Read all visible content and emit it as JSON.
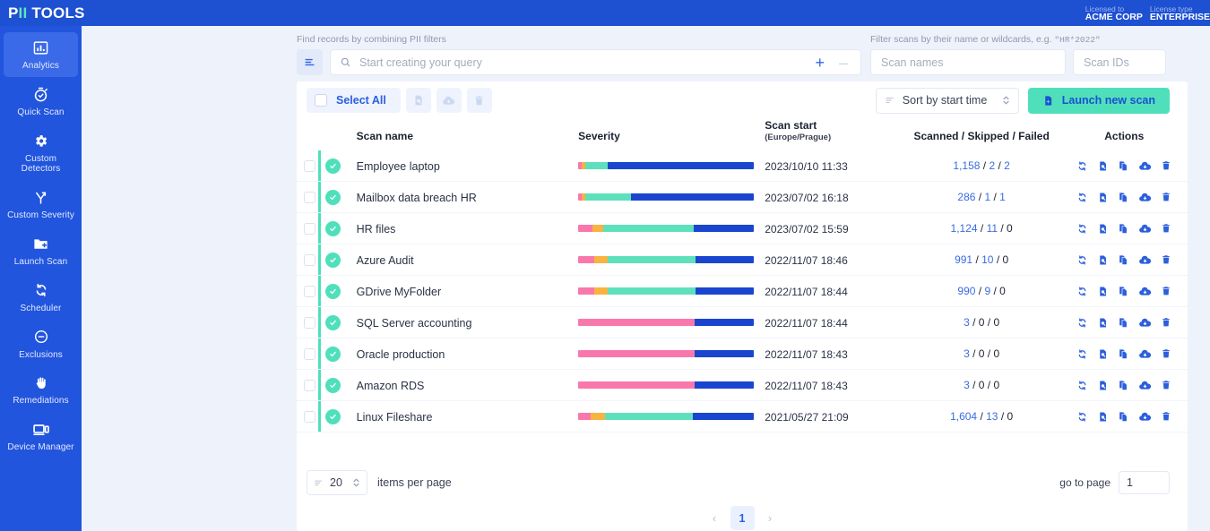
{
  "topbar": {
    "logo_prefix": "P",
    "logo_accent": "II",
    "logo_suffix": " TOOLS",
    "license": [
      {
        "label": "Licensed to",
        "value": "ACME CORP"
      },
      {
        "label": "License type",
        "value": "ENTERPRISE"
      }
    ]
  },
  "sidebar": {
    "items": [
      {
        "label": "Analytics",
        "icon": "chart-bar-icon",
        "active": true
      },
      {
        "label": "Quick Scan",
        "icon": "stopwatch-icon",
        "active": false
      },
      {
        "label": "Custom Detectors",
        "icon": "gear-icon",
        "active": false
      },
      {
        "label": "Custom Severity",
        "icon": "branch-icon",
        "active": false
      },
      {
        "label": "Launch Scan",
        "icon": "folder-plus-icon",
        "active": false
      },
      {
        "label": "Scheduler",
        "icon": "refresh-icon",
        "active": false
      },
      {
        "label": "Exclusions",
        "icon": "minus-circle-icon",
        "active": false
      },
      {
        "label": "Remediations",
        "icon": "hand-icon",
        "active": false
      },
      {
        "label": "Device Manager",
        "icon": "monitor-icon",
        "active": false
      }
    ]
  },
  "filters": {
    "query_hint": "Find records by combining PII filters",
    "query_placeholder": "Start creating your query",
    "query_value": "",
    "add_condition_label": "+",
    "remove_condition_label": "–",
    "scan_hint_prefix": "Filter scans by their name or wildcards, e.g. ",
    "scan_hint_example": "\"HR*2022\"",
    "scan_names_placeholder": "Scan names",
    "scan_names_value": "",
    "scan_ids_placeholder": "Scan IDs",
    "scan_ids_value": ""
  },
  "toolbar": {
    "select_all_label": "Select All",
    "disabled_actions": [
      "report-icon",
      "cloud-download-icon",
      "trash-icon"
    ],
    "sort_label": "Sort by start time",
    "launch_label": "Launch new scan"
  },
  "table": {
    "headers": {
      "scan_name": "Scan name",
      "severity": "Severity",
      "scan_start": "Scan start",
      "scan_start_tz": "(Europe/Prague)",
      "counts": "Scanned / Skipped / Failed",
      "actions": "Actions"
    },
    "row_action_icons": [
      "refresh-icon",
      "report-search-icon",
      "copy-icon",
      "cloud-download-icon",
      "trash-icon"
    ],
    "severity_colors": {
      "critical": "#f978ac",
      "high": "#f9b340",
      "medium": "#5fe0bd",
      "low": "#1a46cf"
    },
    "rows": [
      {
        "name": "Employee laptop",
        "status": "complete",
        "start": "2023/10/10 11:33",
        "scanned": "1,158",
        "skipped": "2",
        "failed": "2",
        "severity": {
          "critical": 2,
          "high": 2,
          "medium": 13,
          "low": 83
        }
      },
      {
        "name": "Mailbox data breach HR",
        "status": "complete",
        "start": "2023/07/02 16:18",
        "scanned": "286",
        "skipped": "1",
        "failed": "1",
        "severity": {
          "critical": 2,
          "high": 2,
          "medium": 26,
          "low": 70
        }
      },
      {
        "name": "HR files",
        "status": "complete",
        "start": "2023/07/02 15:59",
        "scanned": "1,124",
        "skipped": "11",
        "failed": "0",
        "severity": {
          "critical": 8,
          "high": 6,
          "medium": 52,
          "low": 34
        }
      },
      {
        "name": "Azure Audit",
        "status": "complete",
        "start": "2022/11/07 18:46",
        "scanned": "991",
        "skipped": "10",
        "failed": "0",
        "severity": {
          "critical": 9,
          "high": 8,
          "medium": 50,
          "low": 33
        }
      },
      {
        "name": "GDrive MyFolder",
        "status": "complete",
        "start": "2022/11/07 18:44",
        "scanned": "990",
        "skipped": "9",
        "failed": "0",
        "severity": {
          "critical": 9,
          "high": 8,
          "medium": 50,
          "low": 33
        }
      },
      {
        "name": "SQL Server accounting",
        "status": "complete",
        "start": "2022/11/07 18:44",
        "scanned": "3",
        "skipped": "0",
        "failed": "0",
        "severity": {
          "critical": 66,
          "high": 0,
          "medium": 0,
          "low": 34
        }
      },
      {
        "name": "Oracle production",
        "status": "complete",
        "start": "2022/11/07 18:43",
        "scanned": "3",
        "skipped": "0",
        "failed": "0",
        "severity": {
          "critical": 66,
          "high": 0,
          "medium": 0,
          "low": 34
        }
      },
      {
        "name": "Amazon RDS",
        "status": "complete",
        "start": "2022/11/07 18:43",
        "scanned": "3",
        "skipped": "0",
        "failed": "0",
        "severity": {
          "critical": 66,
          "high": 0,
          "medium": 0,
          "low": 34
        }
      },
      {
        "name": "Linux Fileshare",
        "status": "complete",
        "start": "2021/05/27 21:09",
        "scanned": "1,604",
        "skipped": "13",
        "failed": "0",
        "severity": {
          "critical": 7,
          "high": 8,
          "medium": 50,
          "low": 35
        }
      }
    ]
  },
  "footer": {
    "items_per_page_value": "20",
    "items_per_page_label": "items per page",
    "goto_label": "go to page",
    "goto_value": "1",
    "prev_label": "‹",
    "next_label": "›",
    "pages": [
      "1"
    ]
  }
}
